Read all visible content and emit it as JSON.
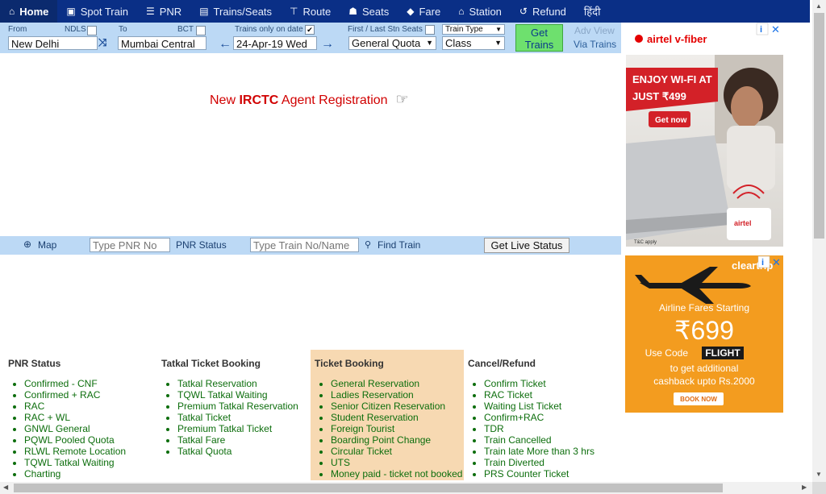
{
  "nav": {
    "items": [
      {
        "label": "Home",
        "icon": "home-icon",
        "glyph": "⌂"
      },
      {
        "label": "Spot Train",
        "icon": "train-icon",
        "glyph": "▣"
      },
      {
        "label": "PNR",
        "icon": "list-icon",
        "glyph": "☰"
      },
      {
        "label": "Trains/Seats",
        "icon": "trains-icon",
        "glyph": "▤"
      },
      {
        "label": "Route",
        "icon": "signpost-icon",
        "glyph": "⊤"
      },
      {
        "label": "Seats",
        "icon": "users-icon",
        "glyph": "☗"
      },
      {
        "label": "Fare",
        "icon": "tag-icon",
        "glyph": "◆"
      },
      {
        "label": "Station",
        "icon": "station-icon",
        "glyph": "⌂"
      },
      {
        "label": "Refund",
        "icon": "undo-icon",
        "glyph": "↺"
      },
      {
        "label": "हिंदी",
        "icon": "",
        "glyph": ""
      }
    ]
  },
  "search": {
    "from_label": "From",
    "from_code": "NDLS",
    "from_value": "New Delhi",
    "to_label": "To",
    "to_code": "BCT",
    "to_value": "Mumbai Central",
    "date_label": "Trains only on date",
    "date_value": "24-Apr-19 Wed",
    "quota_label": "First / Last Stn Seats",
    "quota_value": "General Quota",
    "train_type": "Train Type",
    "class_value": "Class",
    "get_trains": "Get Trains",
    "adv_view": "Adv View",
    "via_trains": "Via Trains"
  },
  "promo": {
    "prefix": "New ",
    "brand": "IRCTC",
    "suffix": " Agent Registration",
    "hand": "☞"
  },
  "pnrbar": {
    "map": "Map",
    "pnr_placeholder": "Type PNR No",
    "pnr_status": "PNR Status",
    "train_placeholder": "Type Train No/Name",
    "find_train": "Find Train",
    "live_status": "Get Live Status"
  },
  "columns": [
    {
      "title": "PNR Status",
      "items": [
        "Confirmed - CNF",
        "Confirmed + RAC",
        "RAC",
        "RAC + WL",
        "GNWL General",
        "PQWL Pooled Quota",
        "RLWL Remote Location",
        "TQWL Tatkal Waiting",
        "Charting"
      ]
    },
    {
      "title": "Tatkal Ticket Booking",
      "items": [
        "Tatkal Reservation",
        "TQWL Tatkal Waiting",
        "Premium Tatkal Reservation",
        "Tatkal Ticket",
        "Premium Tatkal Ticket",
        "Tatkal Fare",
        "Tatkal Quota"
      ]
    },
    {
      "title": "Ticket Booking",
      "items": [
        "General Reservation",
        "Ladies Reservation",
        "Senior Citizen Reservation",
        "Student Reservation",
        "Foreign Tourist",
        "Boarding Point Change",
        "Circular Ticket",
        "UTS",
        "Money paid - ticket not booked"
      ]
    },
    {
      "title": "Cancel/Refund",
      "items": [
        "Confirm Ticket",
        "RAC Ticket",
        "Waiting List Ticket",
        "Confirm+RAC",
        "TDR",
        "Train Cancelled",
        "Train late More than 3 hrs",
        "Train Diverted",
        "PRS Counter Ticket"
      ]
    }
  ],
  "ad1": {
    "brand": "airtel v-fiber",
    "line1": "ENJOY WI-FI AT",
    "line2": "JUST ₹499",
    "cta": "Get now",
    "router": "airtel",
    "fine": "T&C apply"
  },
  "ad2": {
    "brand": "cleartrip",
    "line1": "Airline Fares Starting",
    "price": "₹699",
    "code_prefix": "Use Code",
    "code": "FLIGHT",
    "line3": "to get additional",
    "line4": "cashback upto Rs.2000",
    "cta": "BOOK NOW"
  },
  "colors": {
    "nav": "#0a2f86",
    "searchbar": "#bcd9f5",
    "promo": "#d10000",
    "link": "#0d6e0d",
    "ad1": "#d32128",
    "ad2": "#f39c1f"
  }
}
